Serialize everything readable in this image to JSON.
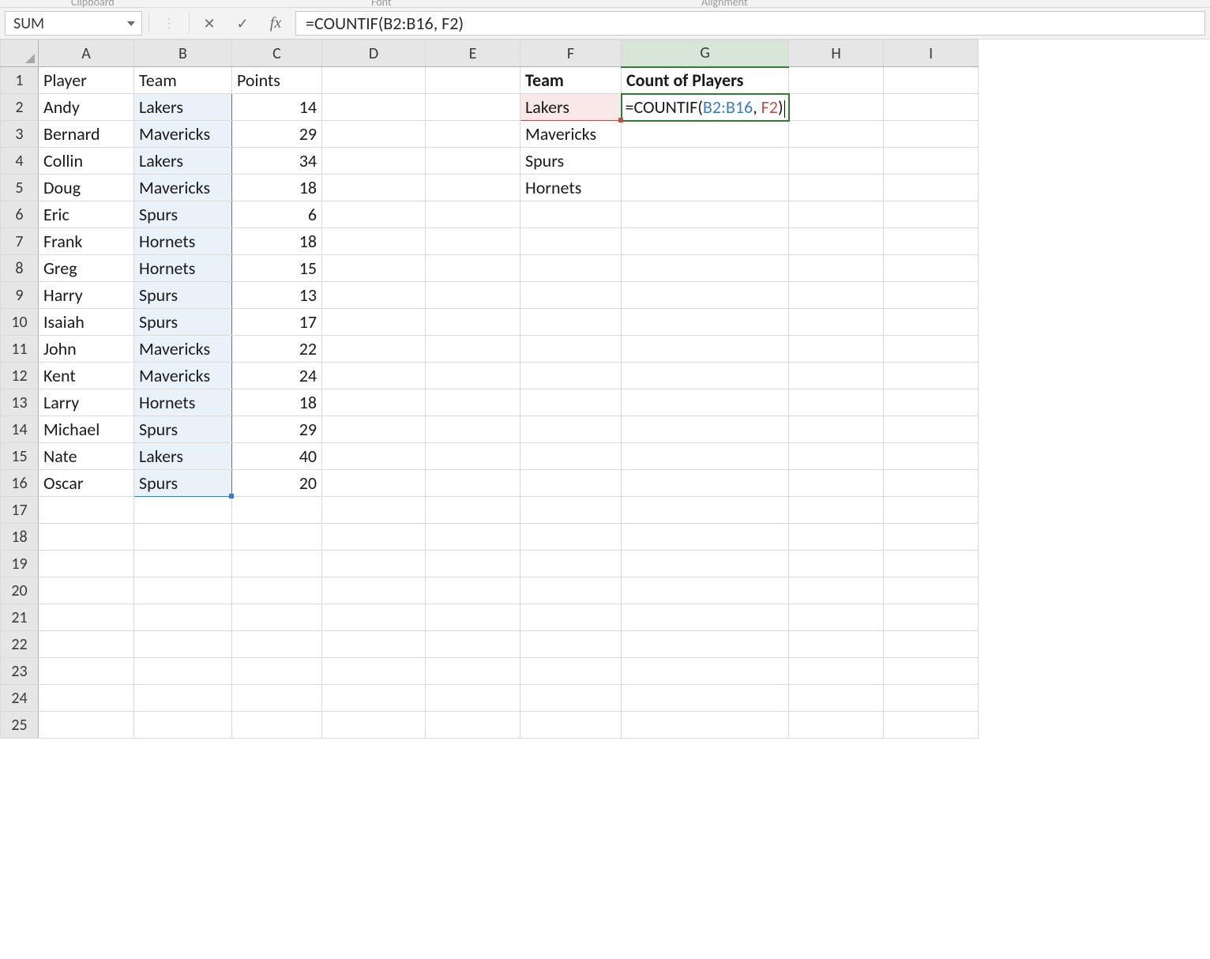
{
  "ribbon": {
    "clipboard_label": "Clipboard",
    "font_label": "Font",
    "alignment_label": "Alignment"
  },
  "formula_bar": {
    "name_box": "SUM",
    "cancel_glyph": "✕",
    "enter_glyph": "✓",
    "fx_glyph": "fx",
    "formula_text": "=COUNTIF(B2:B16, F2)"
  },
  "edit_cell": {
    "prefix": "=COUNTIF(",
    "range": "B2:B16",
    "sep": ", ",
    "ref": "F2",
    "close": ")"
  },
  "columns": [
    "A",
    "B",
    "C",
    "D",
    "E",
    "F",
    "G",
    "H",
    "I"
  ],
  "active_col": "G",
  "row_count": 25,
  "headers": {
    "A1": "Player",
    "B1": "Team",
    "C1": "Points",
    "F1": "Team",
    "G1": "Count of Players"
  },
  "players": [
    {
      "player": "Andy",
      "team": "Lakers",
      "points": 14
    },
    {
      "player": "Bernard",
      "team": "Mavericks",
      "points": 29
    },
    {
      "player": "Collin",
      "team": "Lakers",
      "points": 34
    },
    {
      "player": "Doug",
      "team": "Mavericks",
      "points": 18
    },
    {
      "player": "Eric",
      "team": "Spurs",
      "points": 6
    },
    {
      "player": "Frank",
      "team": "Hornets",
      "points": 18
    },
    {
      "player": "Greg",
      "team": "Hornets",
      "points": 15
    },
    {
      "player": "Harry",
      "team": "Spurs",
      "points": 13
    },
    {
      "player": "Isaiah",
      "team": "Spurs",
      "points": 17
    },
    {
      "player": "John",
      "team": "Mavericks",
      "points": 22
    },
    {
      "player": "Kent",
      "team": "Mavericks",
      "points": 24
    },
    {
      "player": "Larry",
      "team": "Hornets",
      "points": 18
    },
    {
      "player": "Michael",
      "team": "Spurs",
      "points": 29
    },
    {
      "player": "Nate",
      "team": "Lakers",
      "points": 40
    },
    {
      "player": "Oscar",
      "team": "Spurs",
      "points": 20
    }
  ],
  "team_list": [
    "Lakers",
    "Mavericks",
    "Spurs",
    "Hornets"
  ]
}
